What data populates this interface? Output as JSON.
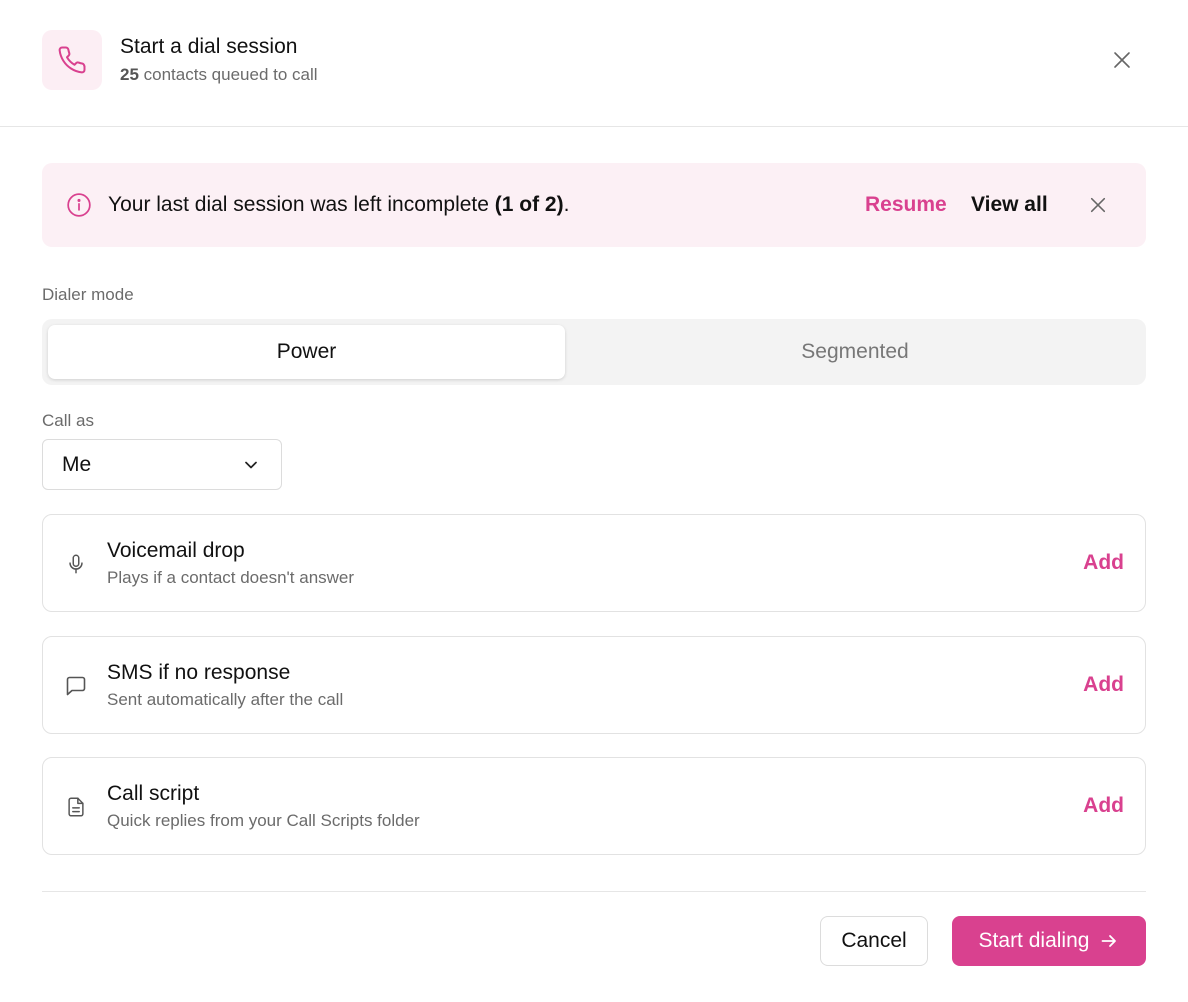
{
  "header": {
    "icon": "phone-icon",
    "title": "Start a dial session",
    "contacts_count": "25",
    "subtitle_suffix": " contacts queued to call",
    "close_icon": "close-icon"
  },
  "banner": {
    "icon": "info-icon",
    "message": "Your last dial session was left incomplete ",
    "message_bold": "(1 of 2)",
    "message_end": ".",
    "resume_label": "Resume",
    "view_all_label": "View all",
    "close_icon": "close-icon"
  },
  "dialer_mode": {
    "label": "Dialer mode",
    "options": [
      {
        "label": "Power",
        "selected": true
      },
      {
        "label": "Segmented",
        "selected": false
      }
    ]
  },
  "call_as": {
    "label": "Call as",
    "value": "Me",
    "icon": "chevron-down-icon"
  },
  "cards": [
    {
      "icon": "microphone-icon",
      "title": "Voicemail drop",
      "subtitle": "Plays if a contact doesn't answer",
      "action": "Add"
    },
    {
      "icon": "message-icon",
      "title": "SMS if no response",
      "subtitle": "Sent automatically after the call",
      "action": "Add"
    },
    {
      "icon": "document-icon",
      "title": "Call script",
      "subtitle": "Quick replies from your Call Scripts folder",
      "action": "Add"
    }
  ],
  "footer": {
    "cancel_label": "Cancel",
    "start_label": "Start dialing",
    "start_icon": "arrow-right-icon"
  },
  "colors": {
    "accent": "#d9418f",
    "banner_bg": "#fcf0f5",
    "icon_tile_bg": "#fceef4"
  }
}
